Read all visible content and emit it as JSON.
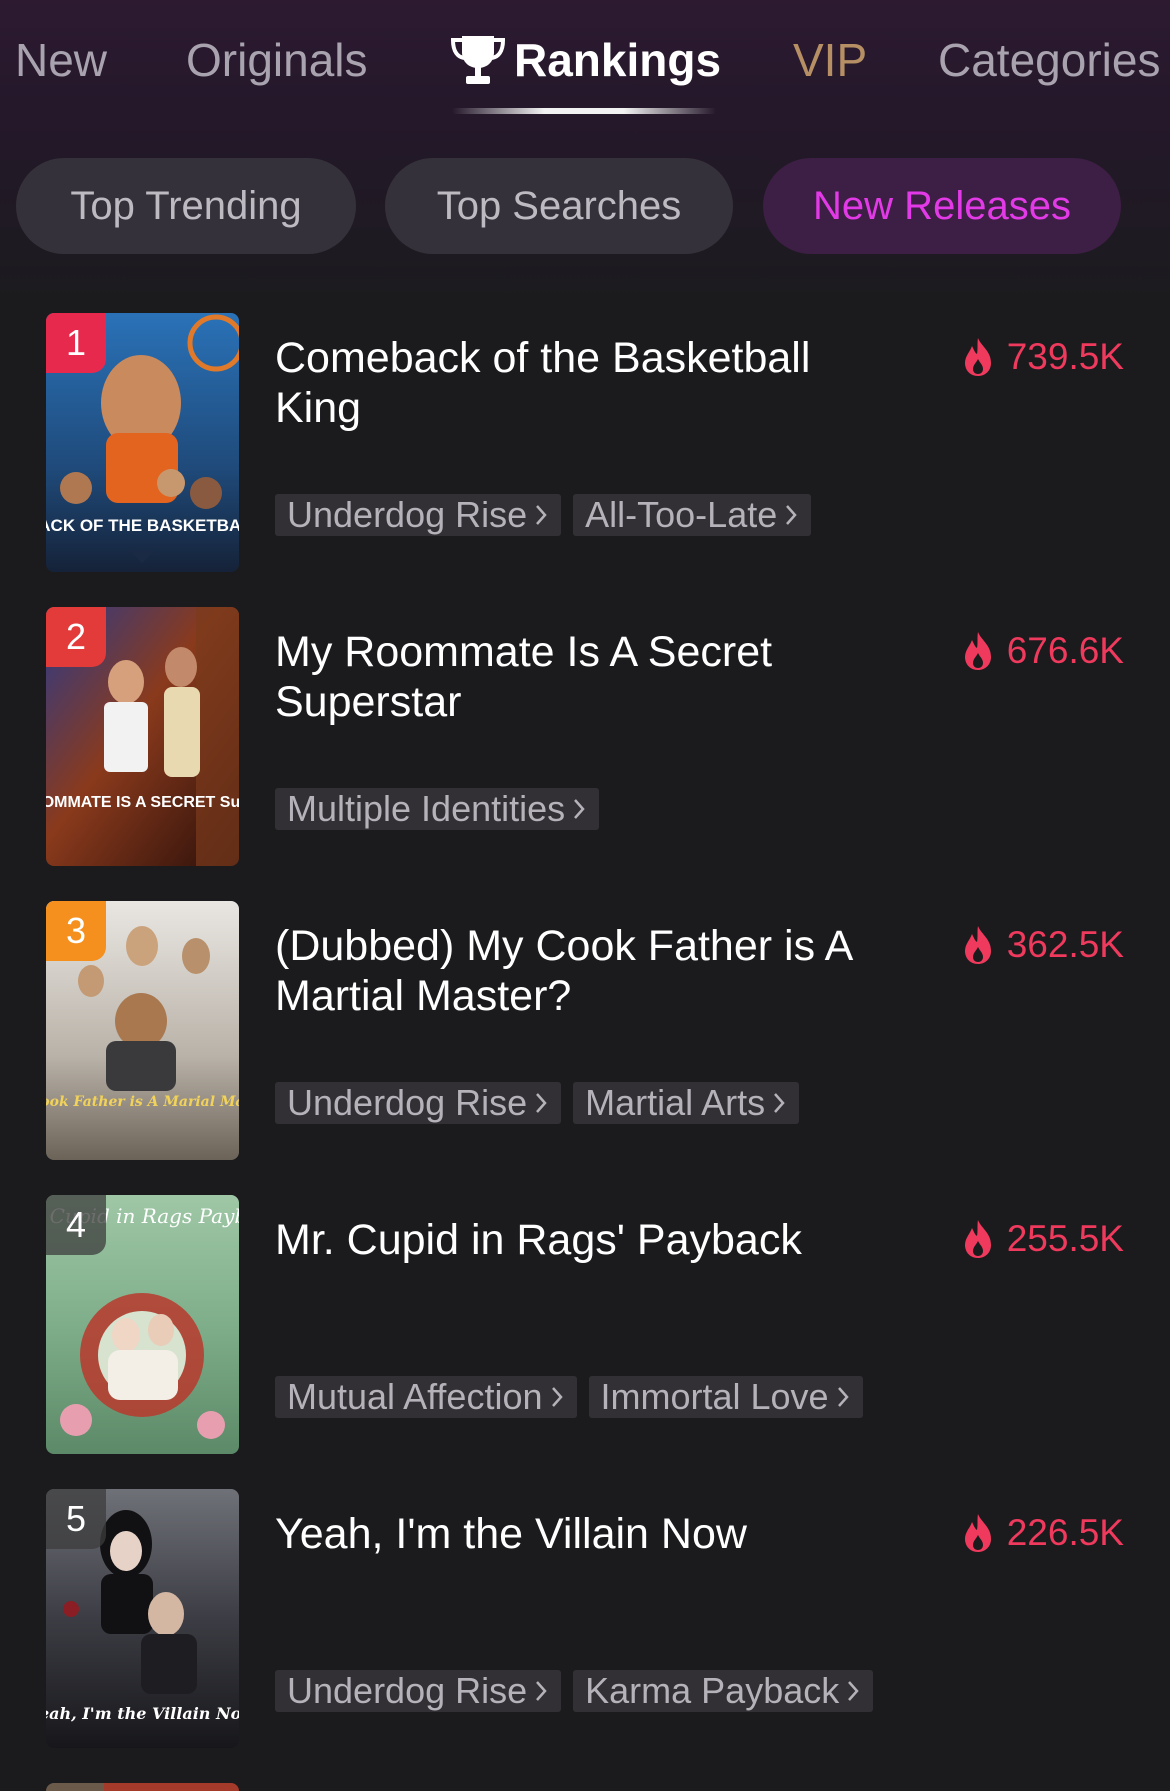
{
  "tabs": {
    "new": "New",
    "originals": "Originals",
    "rankings": "Rankings",
    "vip": "VIP",
    "categories": "Categories"
  },
  "subtabs": {
    "top_trending": "Top Trending",
    "top_searches": "Top Searches",
    "new_releases": "New Releases"
  },
  "colors": {
    "accent": "#e23ae6",
    "heat": "#ef3a5d",
    "vip": "#b68f64",
    "rank_1": "#e8294e",
    "rank_2": "#e23b39",
    "rank_3": "#f5901e"
  },
  "items": [
    {
      "rank": "1",
      "title": "Comeback of the Basketball King",
      "heat": "739.5K",
      "tags": [
        "Underdog Rise",
        "All-Too-Late"
      ]
    },
    {
      "rank": "2",
      "title": "My Roommate Is A Secret Superstar",
      "heat": "676.6K",
      "tags": [
        "Multiple Identities"
      ]
    },
    {
      "rank": "3",
      "title": "(Dubbed) My Cook Father is A Martial Master?",
      "heat": "362.5K",
      "tags": [
        "Underdog Rise",
        "Martial Arts"
      ]
    },
    {
      "rank": "4",
      "title": "Mr. Cupid in Rags' Payback",
      "heat": "255.5K",
      "tags": [
        "Mutual Affection",
        "Immortal Love"
      ]
    },
    {
      "rank": "5",
      "title": "Yeah, I'm the Villain Now",
      "heat": "226.5K",
      "tags": [
        "Underdog Rise",
        "Karma Payback"
      ]
    }
  ],
  "posters": [
    {
      "caption": "COMEBACK OF THE BASKETBALL KING"
    },
    {
      "caption": "MY ROOMMATE IS A SECRET Superstar"
    },
    {
      "caption": "My Cook Father is A Marial Master?"
    },
    {
      "caption": "Cupid in Rags Payback"
    },
    {
      "caption": "Yeah, I'm the Villain Now"
    }
  ],
  "icons": {
    "trophy": "trophy-icon",
    "fire": "fire-icon",
    "chevron": "chevron-right-icon"
  }
}
